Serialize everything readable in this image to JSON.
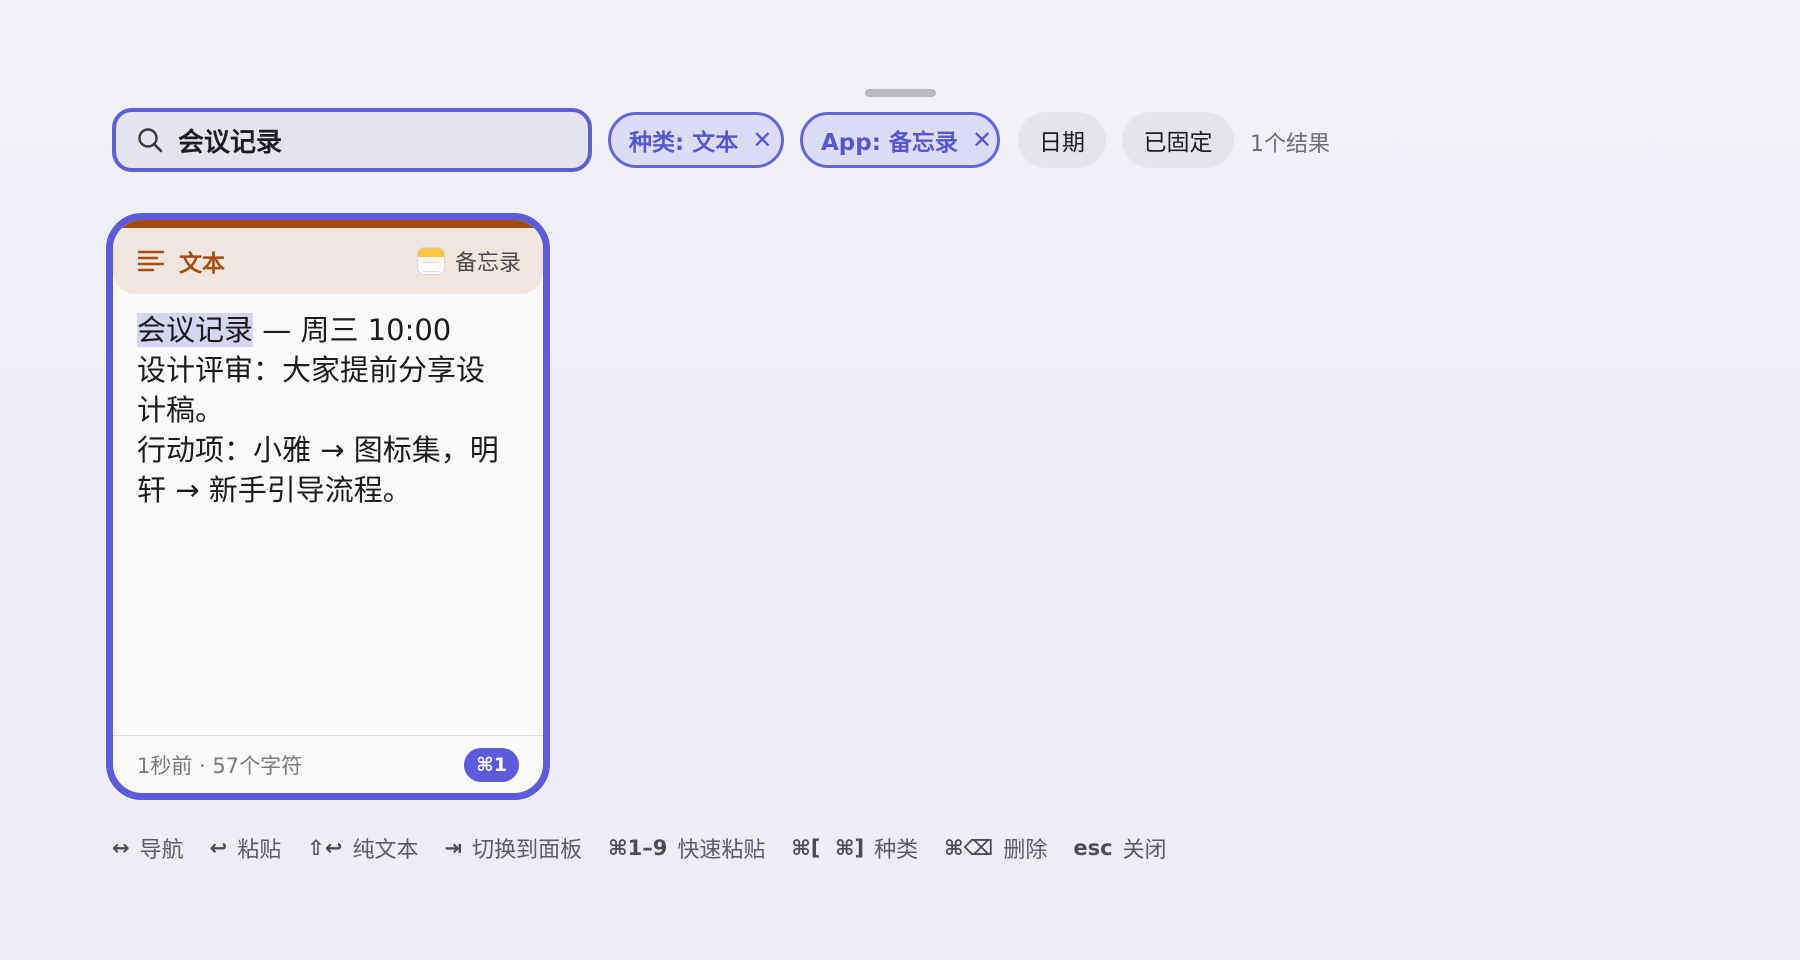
{
  "search": {
    "query": "会议记录",
    "icon": "search-icon"
  },
  "filters": [
    {
      "label": "种类: 文本",
      "active": true
    },
    {
      "label": "App: 备忘录",
      "active": true
    },
    {
      "label": "日期",
      "active": false
    },
    {
      "label": "已固定",
      "active": false
    }
  ],
  "result_count": "1个结果",
  "card": {
    "type_label": "文本",
    "source_app": "备忘录",
    "body": {
      "highlight": "会议记录",
      "line1_rest": " — 周三 10:00",
      "line2": "设计评审：大家提前分享设",
      "line3": "计稿。",
      "line4": "行动项：小雅 → 图标集，明",
      "line5": "轩 → 新手引导流程。"
    },
    "meta": "1秒前 · 57个字符",
    "shortcut": "⌘1"
  },
  "hints": [
    {
      "key": "↔",
      "label": "导航"
    },
    {
      "key": "↩",
      "label": "粘贴"
    },
    {
      "key": "⇧↩",
      "label": "纯文本"
    },
    {
      "key": "⇥",
      "label": "切换到面板"
    },
    {
      "key": "⌘1–9",
      "label": "快速粘贴"
    },
    {
      "key": "⌘[  ⌘]",
      "label": "种类"
    },
    {
      "key": "⌘⌫",
      "label": "删除"
    },
    {
      "key": "esc",
      "label": "关闭"
    }
  ],
  "colors": {
    "accent": "#5b5bdc",
    "text_type": "#a84b12",
    "header_bg": "#f1e6dd"
  }
}
